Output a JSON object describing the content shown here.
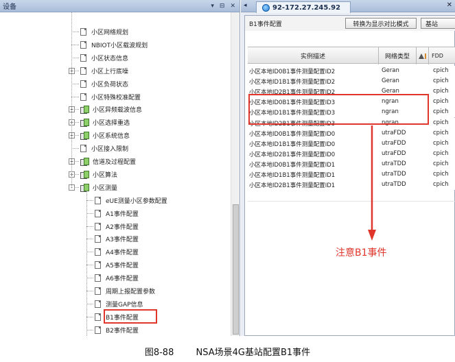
{
  "left_panel": {
    "title": "设备",
    "controls": [
      "▾",
      "⊟",
      "✕"
    ]
  },
  "tree": [
    {
      "label": "小区网络规划",
      "icon": "doc",
      "expander": ""
    },
    {
      "label": "NBIOT小区载波规划",
      "icon": "doc",
      "expander": ""
    },
    {
      "label": "小区状态信息",
      "icon": "doc",
      "expander": ""
    },
    {
      "label": "小区上行底噪",
      "icon": "doc",
      "expander": "+"
    },
    {
      "label": "小区负荷状态",
      "icon": "doc",
      "expander": ""
    },
    {
      "label": "小区特殊校准配置",
      "icon": "doc",
      "expander": ""
    },
    {
      "label": "小区异频载波信息",
      "icon": "folder",
      "expander": "+"
    },
    {
      "label": "小区选择重选",
      "icon": "folder",
      "expander": "+"
    },
    {
      "label": "小区系统信息",
      "icon": "folder",
      "expander": "+"
    },
    {
      "label": "小区接入限制",
      "icon": "doc",
      "expander": ""
    },
    {
      "label": "信道及过程配置",
      "icon": "folder",
      "expander": "+"
    },
    {
      "label": "小区算法",
      "icon": "folder",
      "expander": "+"
    },
    {
      "label": "小区测量",
      "icon": "folder",
      "expander": "-"
    },
    {
      "label": "eUE测量小区参数配置",
      "icon": "doc",
      "expander": ""
    },
    {
      "label": "A1事件配置",
      "icon": "doc",
      "expander": ""
    },
    {
      "label": "A2事件配置",
      "icon": "doc",
      "expander": ""
    },
    {
      "label": "A3事件配置",
      "icon": "doc",
      "expander": ""
    },
    {
      "label": "A4事件配置",
      "icon": "doc",
      "expander": ""
    },
    {
      "label": "A5事件配置",
      "icon": "doc",
      "expander": ""
    },
    {
      "label": "A6事件配置",
      "icon": "doc",
      "expander": ""
    },
    {
      "label": "周期上报配置参数",
      "icon": "doc",
      "expander": ""
    },
    {
      "label": "测量GAP信息",
      "icon": "doc",
      "expander": ""
    },
    {
      "label": "B1事件配置",
      "icon": "doc",
      "expander": ""
    },
    {
      "label": "B2事件配置",
      "icon": "doc",
      "expander": ""
    }
  ],
  "tab": {
    "scroll_arrow": "◂",
    "label": "92-172.27.245.92",
    "close": "✕"
  },
  "config": {
    "title": "B1事件配置",
    "compare_button": "转换为显示对比模式",
    "base_button": "基站"
  },
  "grid": {
    "headers": {
      "desc": "实例描述",
      "type": "网络类型",
      "fdd": "FDD"
    },
    "rows": [
      {
        "desc": "小区本地ID0B1事件测量配置ID2",
        "type": "Geran",
        "fdd": "cpich"
      },
      {
        "desc": "小区本地ID1B1事件测量配置ID2",
        "type": "Geran",
        "fdd": "cpich"
      },
      {
        "desc": "小区本地ID2B1事件测量配置ID2",
        "type": "Geran",
        "fdd": "cpich"
      },
      {
        "desc": "小区本地ID0B1事件测量配置ID3",
        "type": "ngran",
        "fdd": "cpich"
      },
      {
        "desc": "小区本地ID1B1事件测量配置ID3",
        "type": "ngran",
        "fdd": "cpich"
      },
      {
        "desc": "小区本地ID2B1事件测量配置ID3",
        "type": "ngran",
        "fdd": "cpich"
      },
      {
        "desc": "小区本地ID0B1事件测量配置ID0",
        "type": "utraFDD",
        "fdd": "cpich"
      },
      {
        "desc": "小区本地ID1B1事件测量配置ID0",
        "type": "utraFDD",
        "fdd": "cpich"
      },
      {
        "desc": "小区本地ID2B1事件测量配置ID0",
        "type": "utraFDD",
        "fdd": "cpich"
      },
      {
        "desc": "小区本地ID0B1事件测量配置ID1",
        "type": "utraTDD",
        "fdd": "cpich"
      },
      {
        "desc": "小区本地ID1B1事件测量配置ID1",
        "type": "utraTDD",
        "fdd": "cpich"
      },
      {
        "desc": "小区本地ID2B1事件测量配置ID1",
        "type": "utraTDD",
        "fdd": "cpich"
      }
    ]
  },
  "annotation": {
    "note": "注意B1事件",
    "color": "#e0352b"
  },
  "caption": {
    "figure": "图8-88",
    "text": "NSA场景4G基站配置B1事件"
  }
}
